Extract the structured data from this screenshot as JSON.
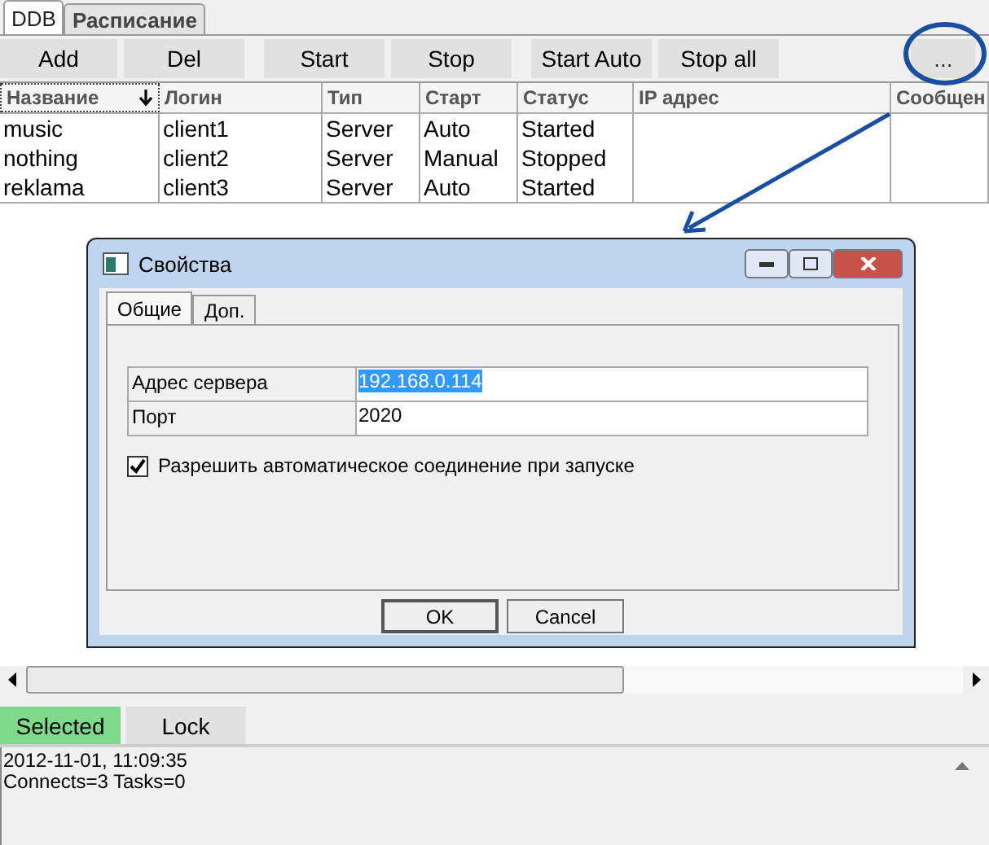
{
  "tabs": [
    {
      "label": "DDB",
      "selected": true
    },
    {
      "label": "Расписание",
      "selected": false
    }
  ],
  "toolbar": {
    "buttons": [
      "Add",
      "Del",
      "Start",
      "Stop",
      "Start Auto",
      "Stop all"
    ],
    "more_button": "..."
  },
  "table": {
    "columns": [
      {
        "label": "Название",
        "sorted": true
      },
      {
        "label": "Логин",
        "sorted": false
      },
      {
        "label": "Тип",
        "sorted": false
      },
      {
        "label": "Старт",
        "sorted": false
      },
      {
        "label": "Статус",
        "sorted": false
      },
      {
        "label": "IP адрес",
        "sorted": false
      },
      {
        "label": "Сообщен",
        "sorted": false
      }
    ],
    "rows": [
      [
        "music",
        "client1",
        "Server",
        "Auto",
        "Started",
        "",
        ""
      ],
      [
        "nothing",
        "client2",
        "Server",
        "Manual",
        "Stopped",
        "",
        ""
      ],
      [
        "reklama",
        "client3",
        "Server",
        "Auto",
        "Started",
        "",
        ""
      ]
    ]
  },
  "dialog": {
    "title": "Свойства",
    "tabs": [
      {
        "label": "Общие",
        "selected": true
      },
      {
        "label": "Доп.",
        "selected": false
      }
    ],
    "fields": [
      {
        "label": "Адрес сервера",
        "value": "192.168.0.114",
        "highlighted": true
      },
      {
        "label": "Порт",
        "value": "2020",
        "highlighted": false
      }
    ],
    "checkbox": {
      "label": "Разрешить автоматическое соединение при запуске",
      "checked": true
    },
    "buttons": [
      "OK",
      "Cancel"
    ]
  },
  "status_buttons": [
    {
      "label": "Selected",
      "on": true
    },
    {
      "label": "Lock",
      "on": false
    }
  ],
  "log": [
    "2012-11-01, 11:09:35",
    "Connects=3 Tasks=0"
  ]
}
